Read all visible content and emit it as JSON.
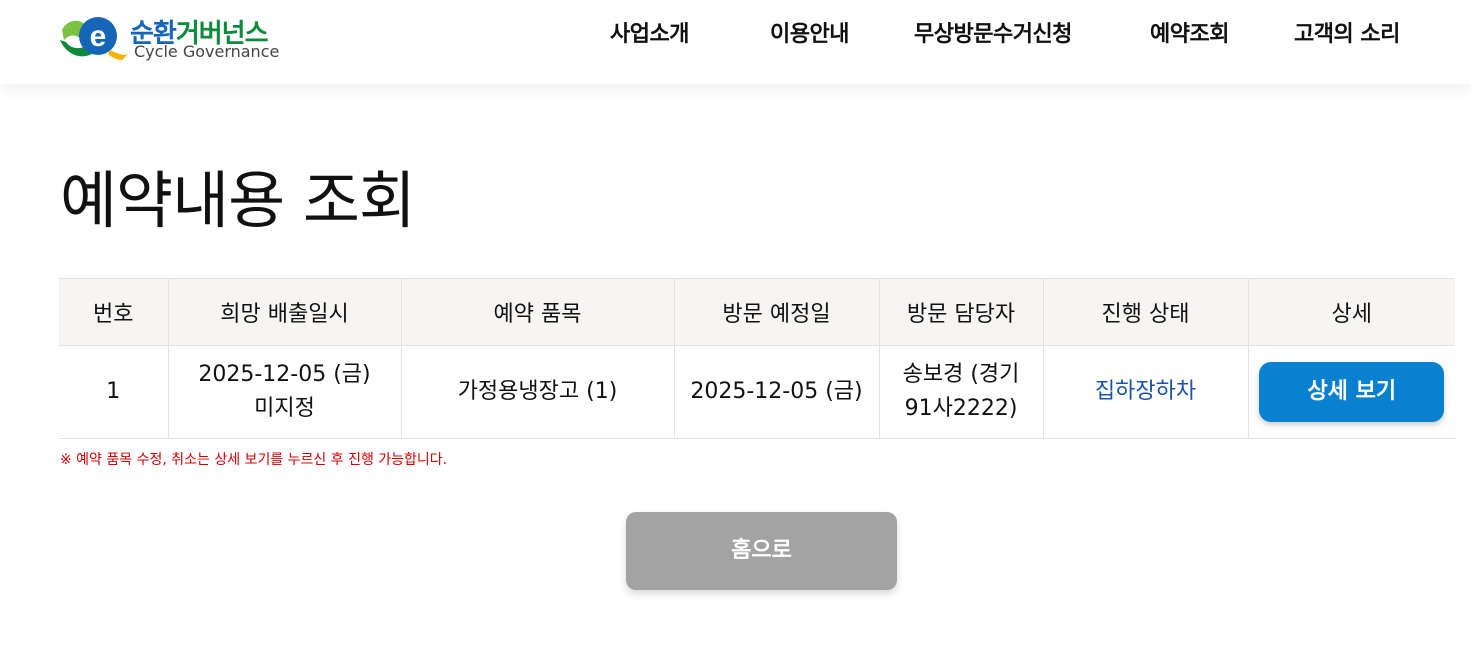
{
  "brand": {
    "name_part1": "순환",
    "name_part2": "거버넌스",
    "name_en": "Cycle Governance",
    "logo_icon": "e-logo-icon"
  },
  "nav": {
    "items": [
      "사업소개",
      "이용안내",
      "무상방문수거신청",
      "예약조회",
      "고객의 소리"
    ]
  },
  "page": {
    "title": "예약내용 조회"
  },
  "table": {
    "headers": [
      "번호",
      "희망 배출일시",
      "예약 품목",
      "방문 예정일",
      "방문 담당자",
      "진행 상태",
      "상세"
    ],
    "rows": [
      {
        "no": "1",
        "desired_date": "2025-12-05 (금)",
        "desired_time": "미지정",
        "item": "가정용냉장고 (1)",
        "visit_date": "2025-12-05 (금)",
        "staff_name": "송보경 (경기",
        "staff_plate": "91사2222)",
        "status": "집하장하차",
        "detail_label": "상세 보기"
      }
    ]
  },
  "notice": "※ 예약 품목 수정, 취소는 상세 보기를 누르신 후 진행 가능합니다.",
  "home_button": "홈으로",
  "colors": {
    "brand_green": "#0d8a3c",
    "brand_blue": "#1565b8",
    "detail_button": "#0a80d0",
    "status_text": "#1a52a8",
    "notice": "#d40000",
    "home_button": "#a3a3a3"
  }
}
